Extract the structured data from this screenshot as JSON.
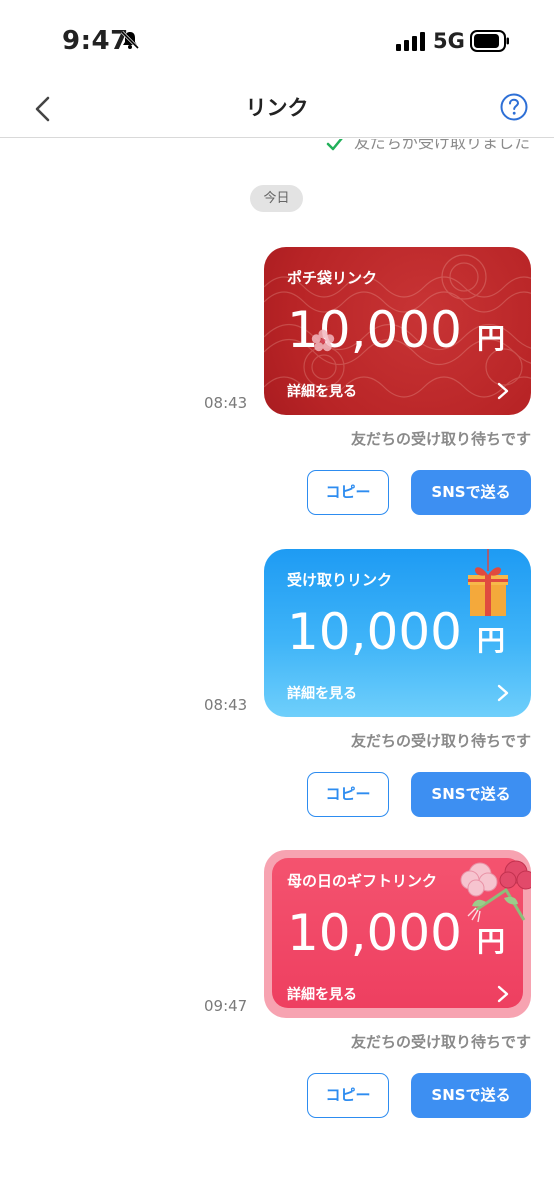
{
  "status_bar": {
    "time": "9:47",
    "network": "5G",
    "icons": [
      "bell-muted-icon",
      "signal-icon",
      "battery-icon"
    ]
  },
  "nav": {
    "title": "リンク",
    "back_icon": "chevron-left-icon",
    "help_icon": "question-circle-icon"
  },
  "previous_status": "友だちが受け取りました",
  "day_label": "今日",
  "messages": [
    {
      "time": "08:43",
      "card": {
        "label": "ポチ袋リンク",
        "amount": "10,000",
        "currency": "円",
        "detail": "詳細を見る",
        "theme": "red"
      },
      "status": "友だちの受け取り待ちです",
      "copy_label": "コピー",
      "sns_label": "SNSで送る"
    },
    {
      "time": "08:43",
      "card": {
        "label": "受け取りリンク",
        "amount": "10,000",
        "currency": "円",
        "detail": "詳細を見る",
        "theme": "blue"
      },
      "status": "友だちの受け取り待ちです",
      "copy_label": "コピー",
      "sns_label": "SNSで送る"
    },
    {
      "time": "09:47",
      "card": {
        "label": "母の日のギフトリンク",
        "amount": "10,000",
        "currency": "円",
        "detail": "詳細を見る",
        "theme": "pink"
      },
      "status": "友だちの受け取り待ちです",
      "copy_label": "コピー",
      "sns_label": "SNSで送る"
    }
  ],
  "colors": {
    "accent": "#3d8ff2",
    "red_card": "#b82426",
    "blue_card": "#2ba6f6",
    "pink_card": "#f04865"
  }
}
